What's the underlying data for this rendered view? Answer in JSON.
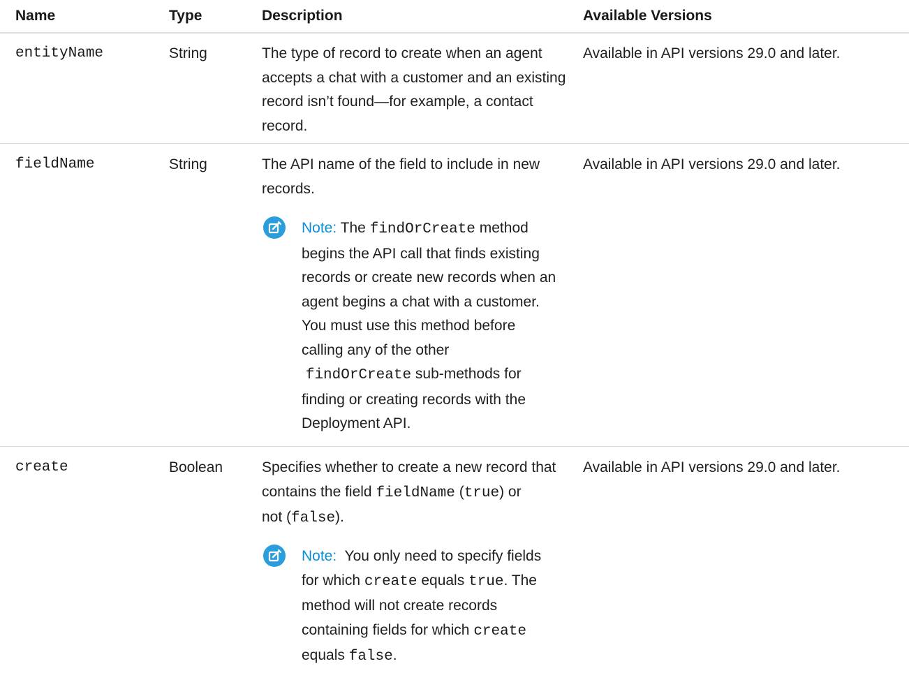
{
  "table": {
    "headers": {
      "name": "Name",
      "type": "Type",
      "description": "Description",
      "versions": "Available Versions"
    },
    "rows": [
      {
        "name": "entityName",
        "type": "String",
        "description": "The type of record to create when an agent accepts a chat with a customer and an existing record isn’t found—for example, a contact record.",
        "desc_lines": [
          "The type of record to create when an agent",
          "accepts a chat with a customer and an existing",
          "record isn’t found—for example, a contact",
          "record."
        ],
        "versions": "Available in API versions 29.0 and later."
      },
      {
        "name": "fieldName",
        "type": "String",
        "desc_lines": [
          "The API name of the field to include in new",
          "records."
        ],
        "note": {
          "label": "Note:",
          "segments": [
            {
              "t": " The ",
              "mono": false
            },
            {
              "t": "findOrCreate",
              "mono": true
            },
            {
              "t": " method",
              "mono": false
            }
          ],
          "lines": [
            "begins the API call that finds existing",
            "records or create new records when an",
            "agent begins a chat with a customer.",
            "You must use this method before",
            "calling any of the other"
          ],
          "mono_line": "findOrCreate",
          "mono_line_rest": " sub-methods for",
          "tail_lines": [
            "finding or creating records with the",
            "Deployment API."
          ]
        },
        "versions": "Available in API versions 29.0 and later."
      },
      {
        "name": "create",
        "type": "Boolean",
        "desc_line1": "Specifies whether to create a new record that",
        "desc_line2_a": "contains the field ",
        "desc_line2_code1": "fieldName",
        "desc_line2_b": " (",
        "desc_line2_code2": "true",
        "desc_line2_c": ") or",
        "desc_line3_a": "not (",
        "desc_line3_code": "false",
        "desc_line3_b": ").",
        "note": {
          "label": "Note:",
          "line1_rest": "  You only need to specify fields",
          "line2_a": "for which ",
          "line2_code1": "create",
          "line2_b": " equals ",
          "line2_code2": "true",
          "line2_c": ". The",
          "line3": "method will not create records",
          "line4_a": "containing fields for which ",
          "line4_code": "create",
          "line5_a": "equals ",
          "line5_code": "false",
          "line5_b": "."
        },
        "versions": "Available in API versions 29.0 and later."
      }
    ]
  },
  "icons": {
    "note_icon": "edit-note-icon",
    "note_icon_color": "#2a9ddc"
  }
}
